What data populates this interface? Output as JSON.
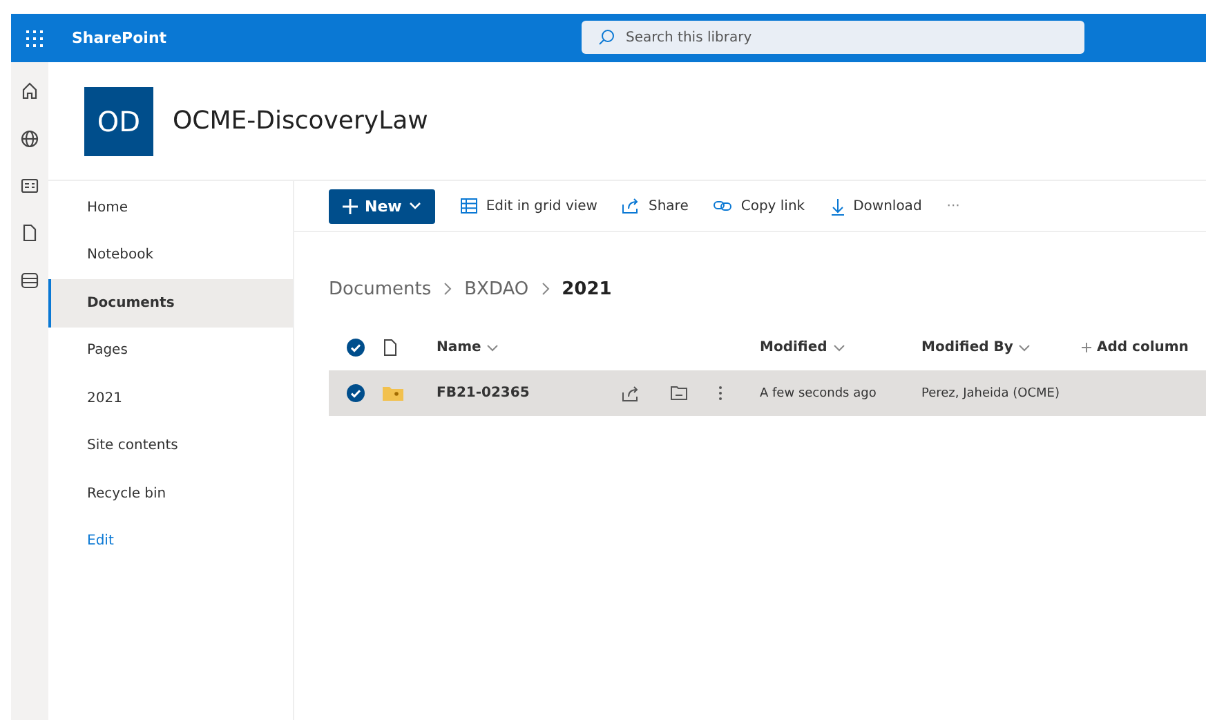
{
  "app_name": "SharePoint",
  "search": {
    "placeholder": "Search this library"
  },
  "rail": [
    {
      "kind": "home"
    },
    {
      "kind": "globe"
    },
    {
      "kind": "news"
    },
    {
      "kind": "file"
    },
    {
      "kind": "list"
    }
  ],
  "site": {
    "initials": "OD",
    "title": "OCME-DiscoveryLaw"
  },
  "nav": [
    {
      "label": "Home",
      "selected": false,
      "kind": "item"
    },
    {
      "label": "Notebook",
      "selected": false,
      "kind": "item"
    },
    {
      "label": "Documents",
      "selected": true,
      "kind": "item"
    },
    {
      "label": "Pages",
      "selected": false,
      "kind": "item"
    },
    {
      "label": "2021",
      "selected": false,
      "kind": "item"
    },
    {
      "label": "Site contents",
      "selected": false,
      "kind": "item"
    },
    {
      "label": "Recycle bin",
      "selected": false,
      "kind": "item"
    },
    {
      "label": "Edit",
      "selected": false,
      "kind": "link"
    }
  ],
  "toolbar": {
    "new_label": "New",
    "actions": [
      {
        "kind": "grid",
        "label": "Edit in grid view"
      },
      {
        "kind": "share",
        "label": "Share"
      },
      {
        "kind": "link",
        "label": "Copy link"
      },
      {
        "kind": "download",
        "label": "Download"
      }
    ],
    "more": "···"
  },
  "breadcrumb": [
    "Documents",
    "BXDAO",
    "2021"
  ],
  "columns": [
    "Name",
    "Modified",
    "Modified By",
    "Add column"
  ],
  "all_selected": true,
  "rows": [
    {
      "name": "FB21-02365",
      "modified": "A few seconds ago",
      "modified_by": "Perez, Jaheida (OCME)",
      "selected": true
    }
  ]
}
